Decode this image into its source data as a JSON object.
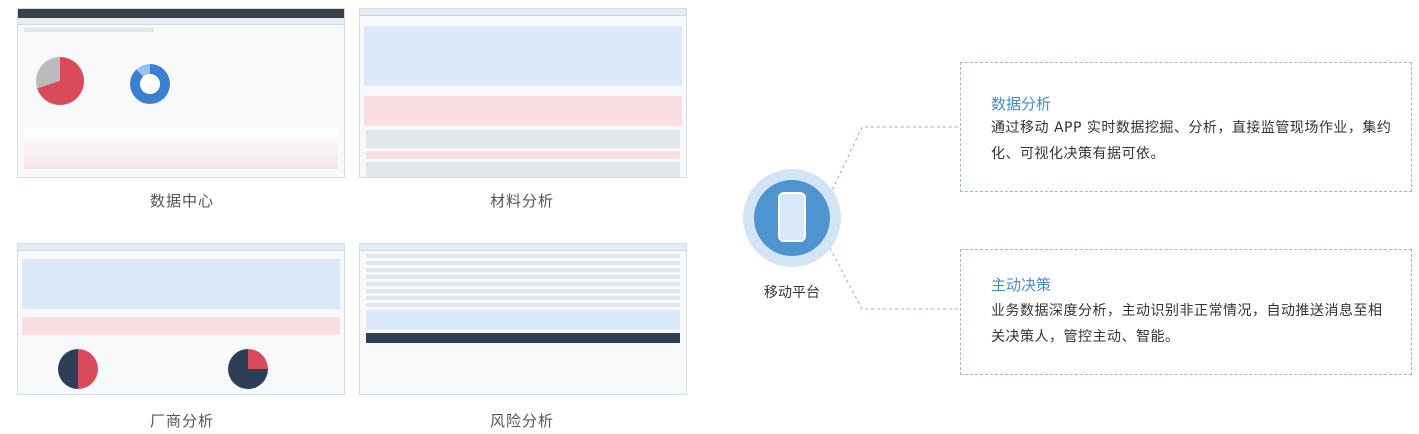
{
  "thumbnails": [
    {
      "caption": "数据中心"
    },
    {
      "caption": "材料分析"
    },
    {
      "caption": "厂商分析"
    },
    {
      "caption": "风险分析"
    }
  ],
  "hub": {
    "label": "移动平台",
    "icon": "mobile-phone-icon"
  },
  "features": [
    {
      "title": "数据分析",
      "description": "通过移动 APP 实时数据挖掘、分析，直接监管现场作业，集约化、可视化决策有据可依。"
    },
    {
      "title": "主动决策",
      "description": "业务数据深度分析，主动识别非正常情况，自动推送消息至相关决策人，管控主动、智能。"
    }
  ],
  "colors": {
    "accent": "#4a8bc9",
    "hub": "#4e94d1",
    "border": "#9bb8d8"
  }
}
